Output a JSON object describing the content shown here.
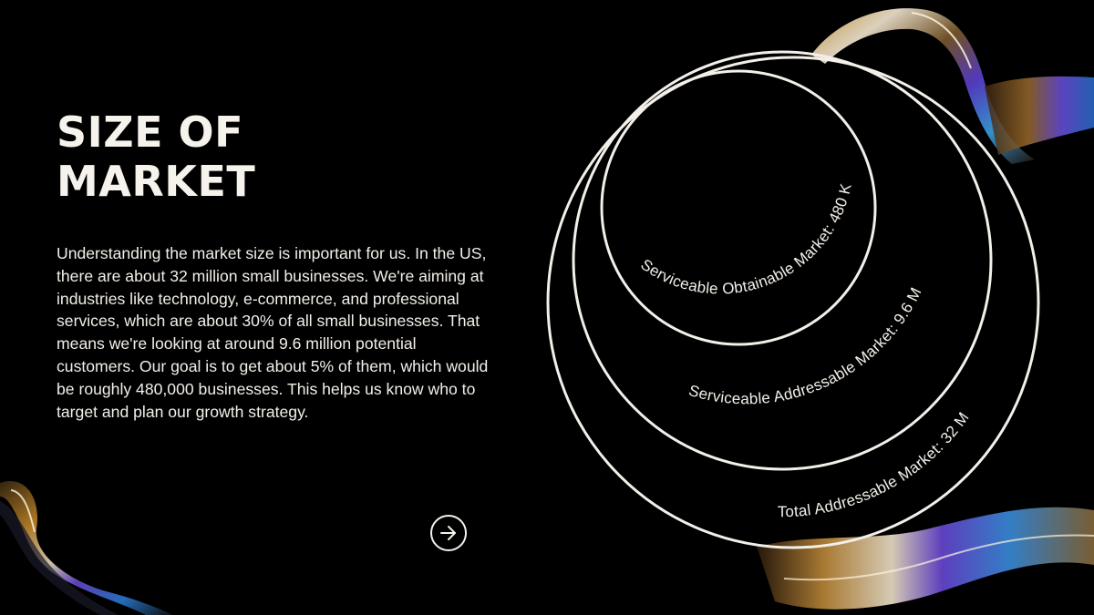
{
  "slide": {
    "title_line1": "SIZE OF",
    "title_line2": "MARKET",
    "body": "Understanding the market size is important for us. In the US, there are about 32 million small businesses. We're aiming at industries like technology, e-commerce, and professional services, which are about 30% of all small businesses. That means we're looking at around 9.6 million potential customers. Our goal is to get about 5% of them, which would be roughly 480,000 businesses. This helps us know who to target and plan our growth strategy."
  },
  "diagram": {
    "tam_label": "Total Addressable Market: 32 M",
    "sam_label": "Serviceable Addressable Market: 9.6 M",
    "som_label": "Serviceable Obtainable Market: 480 K",
    "ring_color": "#f3efe9"
  },
  "navigation": {
    "next_icon": "arrow-right-icon"
  },
  "decoration": {
    "glass_ribbon_icon": "iridescent-glass-ribbon"
  }
}
